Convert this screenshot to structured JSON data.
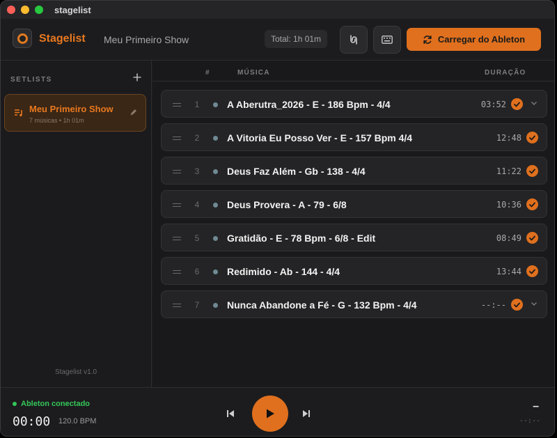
{
  "window": {
    "title": "stagelist"
  },
  "header": {
    "app_name": "Stagelist",
    "show_name": "Meu Primeiro Show",
    "total": "Total: 1h 01m",
    "load_button": "Carregar do Ableton",
    "icons": {
      "routing": "routing-icon",
      "keyboard": "keyboard-icon",
      "sync": "sync-icon"
    }
  },
  "sidebar": {
    "title": "SETLISTS",
    "setlists": [
      {
        "name": "Meu Primeiro Show",
        "meta": "7 músicas • 1h 01m",
        "active": true
      }
    ],
    "version": "Stagelist v1.0"
  },
  "table": {
    "headers": {
      "num": "#",
      "music": "MÚSICA",
      "duration": "DURAÇÃO"
    },
    "rows": [
      {
        "num": "1",
        "title": "A Aberutra_2026 - E - 186 Bpm - 4/4",
        "duration": "03:52",
        "done": true,
        "chevron": true
      },
      {
        "num": "2",
        "title": "A Vitoria Eu Posso Ver - E - 157 Bpm 4/4",
        "duration": "12:48",
        "done": true,
        "chevron": false
      },
      {
        "num": "3",
        "title": "Deus Faz Além - Gb - 138 - 4/4",
        "duration": "11:22",
        "done": true,
        "chevron": false
      },
      {
        "num": "4",
        "title": "Deus Provera - A - 79 - 6/8",
        "duration": "10:36",
        "done": true,
        "chevron": false
      },
      {
        "num": "5",
        "title": "Gratidão - E - 78 Bpm - 6/8 - Edit",
        "duration": "08:49",
        "done": true,
        "chevron": false
      },
      {
        "num": "6",
        "title": "Redimido - Ab - 144 - 4/4",
        "duration": "13:44",
        "done": true,
        "chevron": false
      },
      {
        "num": "7",
        "title": "Nunca Abandone a Fé - G - 132 Bpm - 4/4",
        "duration": "--:--",
        "done": true,
        "chevron": true
      }
    ]
  },
  "footer": {
    "connection": "Ableton conectado",
    "time": "00:00",
    "bpm": "120.0 BPM",
    "right_dash": "–",
    "right_time": "--:--"
  },
  "colors": {
    "accent": "#e0701e",
    "connected": "#34c759",
    "background": "#1e1e20"
  }
}
